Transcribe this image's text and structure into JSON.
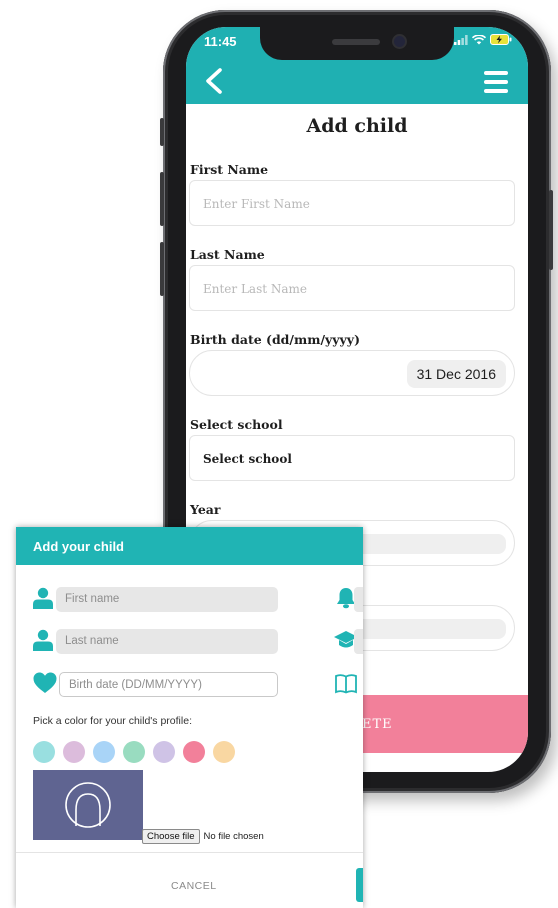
{
  "phone": {
    "status": {
      "time": "11:45"
    },
    "app_title": "Add child",
    "fields": {
      "first_name": {
        "label": "First Name",
        "placeholder": "Enter First Name"
      },
      "last_name": {
        "label": "Last Name",
        "placeholder": "Enter Last Name"
      },
      "birth_date": {
        "label": "Birth date (dd/mm/yyyy)",
        "value": "31 Dec 2016"
      },
      "school": {
        "label": "Select school",
        "value": "Select school"
      },
      "year": {
        "label": "Year"
      }
    },
    "complete_button": "ETE"
  },
  "dialog": {
    "title": "Add your child",
    "first_name_placeholder": "First name",
    "last_name_placeholder": "Last name",
    "birth_date_placeholder": "Birth date (DD/MM/YYYY)",
    "color_prompt": "Pick a color for your child's profile:",
    "colors": [
      "#99dfe0",
      "#dcbcdc",
      "#a9d4f7",
      "#99dcc0",
      "#cfc3e6",
      "#f2809a",
      "#f9d7a2"
    ],
    "file_button": "Choose file",
    "file_status": "No file chosen",
    "cancel_label": "CANCEL"
  },
  "colors": {
    "brand_teal": "#1fb0b2",
    "accent_pink": "#f2809a",
    "avatar_bg": "#5f6491"
  },
  "icons": {
    "back": "chevron-left-icon",
    "menu": "hamburger-icon",
    "person": "person-icon",
    "heart": "heart-icon",
    "bell": "bell-icon",
    "graduation": "graduation-cap-icon",
    "book": "book-icon"
  }
}
